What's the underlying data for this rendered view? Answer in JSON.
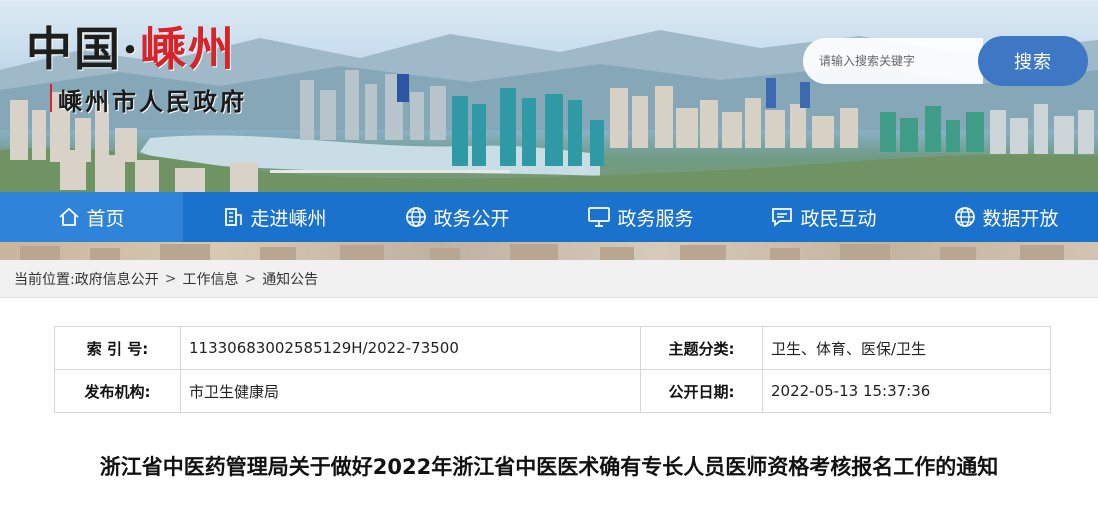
{
  "header": {
    "logo_main": "中国·",
    "logo_city": "嵊州",
    "logo_sub": "嵊州市人民政府"
  },
  "search": {
    "placeholder": "请输入搜索关键字",
    "button_label": "搜索"
  },
  "nav": {
    "items": [
      {
        "label": "首页",
        "icon": "home-icon"
      },
      {
        "label": "走进嵊州",
        "icon": "building-icon"
      },
      {
        "label": "政务公开",
        "icon": "globe-icon"
      },
      {
        "label": "政务服务",
        "icon": "monitor-icon"
      },
      {
        "label": "政民互动",
        "icon": "chat-icon"
      },
      {
        "label": "数据开放",
        "icon": "globe-icon"
      }
    ]
  },
  "breadcrumb": {
    "prefix": "当前位置:",
    "items": [
      "政府信息公开",
      "工作信息",
      "通知公告"
    ],
    "separator": ">"
  },
  "info": {
    "index_label": "索 引 号:",
    "index_value": "11330683002585129H/2022-73500",
    "topic_label": "主题分类:",
    "topic_value": "卫生、体育、医保/卫生",
    "publisher_label": "发布机构:",
    "publisher_value": "市卫生健康局",
    "date_label": "公开日期:",
    "date_value": "2022-05-13 15:37:36"
  },
  "article": {
    "title": "浙江省中医药管理局关于做好2022年浙江省中医医术确有专长人员医师资格考核报名工作的通知"
  },
  "colors": {
    "nav_bg": "#1b72cc",
    "nav_active": "#2f84d9",
    "search_button": "#3e77c3",
    "logo_red": "#d7232a"
  }
}
